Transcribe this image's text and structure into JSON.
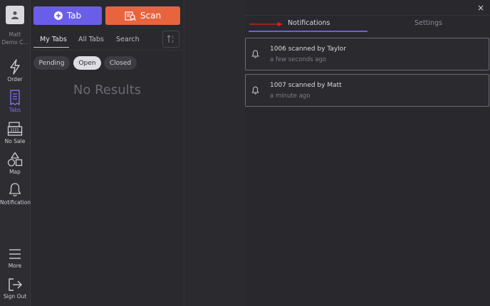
{
  "rail": {
    "user_name": "Matt",
    "user_org": "Demo C...",
    "items": [
      {
        "label": "Order",
        "icon": "lightning-icon"
      },
      {
        "label": "Tabs",
        "icon": "receipt-icon"
      },
      {
        "label": "No Sale",
        "icon": "cash-register-icon"
      },
      {
        "label": "Map",
        "icon": "shapes-icon"
      },
      {
        "label": "Notifications",
        "icon": "bell-icon"
      },
      {
        "label": "More",
        "icon": "menu-icon"
      },
      {
        "label": "Sign Out",
        "icon": "sign-out-icon"
      }
    ],
    "active": "Tabs"
  },
  "tabs_pane": {
    "tab_button": "Tab",
    "scan_button": "Scan",
    "subtabs": [
      "My Tabs",
      "All Tabs",
      "Search"
    ],
    "active_subtab": "My Tabs",
    "filters": [
      "Pending",
      "Open",
      "Closed"
    ],
    "active_filter": "Open",
    "empty_text": "No Results"
  },
  "panel": {
    "tabs": [
      "Notifications",
      "Settings"
    ],
    "active_tab": "Notifications",
    "close_label": "×",
    "notifications": [
      {
        "title": "1006 scanned by Taylor",
        "time": "a few seconds ago"
      },
      {
        "title": "1007 scanned by Matt",
        "time": "a minute ago"
      }
    ]
  },
  "colors": {
    "accent": "#6a5ee8",
    "scan": "#e8643f",
    "arrow": "#e02020",
    "background": "#2b2a2f"
  }
}
